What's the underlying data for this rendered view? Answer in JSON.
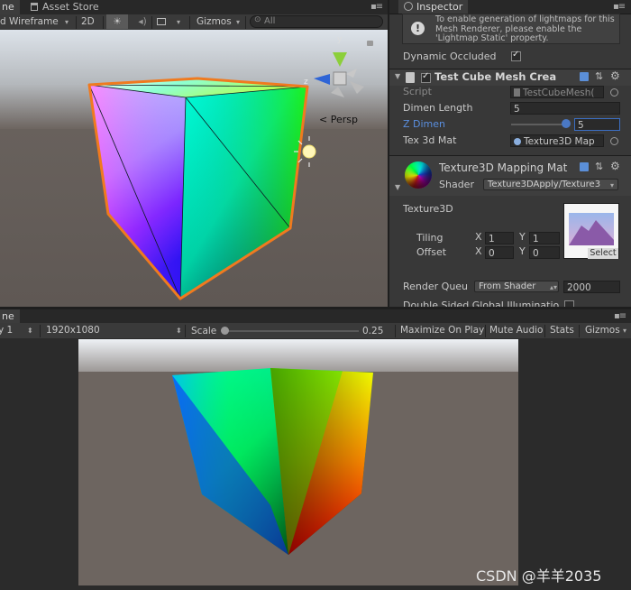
{
  "scene_tabs": {
    "scene_tab": "ne",
    "asset_store_tab": "Asset Store"
  },
  "scene_toolbar": {
    "shading_mode": "d Wireframe",
    "mode_2d": "2D",
    "gizmos_label": "Gizmos",
    "search_placeholder": "All"
  },
  "scene": {
    "persp_label": "Persp",
    "axis_y": "y",
    "axis_z": "z"
  },
  "inspector": {
    "tab_label": "Inspector",
    "lightmap_info": "To enable generation of lightmaps for this Mesh Renderer, please enable the 'Lightmap Static' property.",
    "dynamic_occluded_label": "Dynamic Occluded",
    "script_component": {
      "title": "Test Cube Mesh Crea",
      "script_label": "Script",
      "script_value": "TestCubeMesh(",
      "dimen_length_label": "Dimen Length",
      "dimen_length_value": "5",
      "z_dimen_label": "Z Dimen",
      "z_dimen_value": "5",
      "tex3d_label": "Tex 3d Mat",
      "tex3d_value": "Texture3D Map"
    },
    "material": {
      "title": "Texture3D Mapping Mat",
      "shader_label": "Shader",
      "shader_value": "Texture3DApply/Texture3",
      "texture_label": "Texture3D",
      "tiling_label": "Tiling",
      "offset_label": "Offset",
      "x_label": "X",
      "y_label": "Y",
      "tiling_x": "1",
      "tiling_y": "1",
      "offset_x": "0",
      "offset_y": "0",
      "select_label": "Select",
      "render_queue_label": "Render Queu",
      "render_queue_mode": "From Shader",
      "render_queue_value": "2000",
      "double_sided_label": "Double Sided Global Illuminatio"
    }
  },
  "game_tabs": {
    "game_tab": "ne"
  },
  "game_toolbar": {
    "display": "y 1",
    "resolution": "1920x1080",
    "scale_label": "Scale",
    "scale_value": "0.25",
    "maximize_on_play": "Maximize On Play",
    "mute_audio": "Mute Audio",
    "stats": "Stats",
    "gizmos": "Gizmos"
  },
  "watermark": "CSDN @羊羊2035",
  "colors": {
    "editor_bg": "#383838",
    "selection_outline": "#f07a1f",
    "link_blue": "#5a8fe0",
    "game_bg_top": "#e8ecf0",
    "ground": "#6d6560"
  }
}
